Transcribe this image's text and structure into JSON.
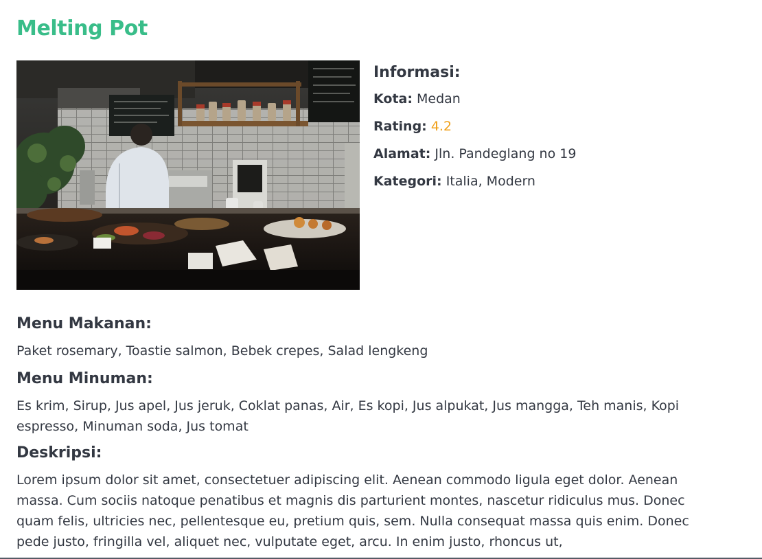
{
  "page": {
    "title": "Melting Pot",
    "title_color": "#39bd89"
  },
  "photo": {
    "alt": "Restaurant kitchen with chef and food counter"
  },
  "info": {
    "heading": "Informasi:",
    "kota_label": "Kota:",
    "kota_value": "Medan",
    "rating_label": "Rating:",
    "rating_value": "4.2",
    "rating_color": "#f0a01a",
    "alamat_label": "Alamat:",
    "alamat_value": "Jln. Pandeglang no 19",
    "kategori_label": "Kategori:",
    "kategori_value": "Italia, Modern"
  },
  "menu_makanan": {
    "heading": "Menu Makanan:",
    "text": "Paket rosemary, Toastie salmon, Bebek crepes, Salad lengkeng"
  },
  "menu_minuman": {
    "heading": "Menu Minuman:",
    "text": "Es krim, Sirup, Jus apel, Jus jeruk, Coklat panas, Air, Es kopi, Jus alpukat, Jus mangga, Teh manis, Kopi espresso, Minuman soda, Jus tomat"
  },
  "deskripsi": {
    "heading": "Deskripsi:",
    "text": "Lorem ipsum dolor sit amet, consectetuer adipiscing elit. Aenean commodo ligula eget dolor. Aenean massa. Cum sociis natoque penatibus et magnis dis parturient montes, nascetur ridiculus mus. Donec quam felis, ultricies nec, pellentesque eu, pretium quis, sem. Nulla consequat massa quis enim. Donec pede justo, fringilla vel, aliquet nec, vulputate eget, arcu. In enim justo, rhoncus ut,"
  }
}
